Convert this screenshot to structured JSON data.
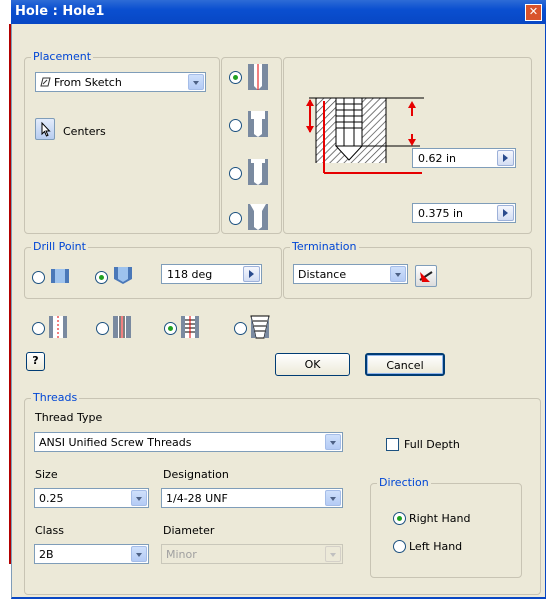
{
  "window": {
    "title": "Hole : Hole1"
  },
  "placement": {
    "legend": "Placement",
    "source_value": "From Sketch",
    "centers_label": "Centers"
  },
  "hole_types": [
    "drilled",
    "counterbore",
    "spotface",
    "countersink"
  ],
  "selected_hole_type": "drilled",
  "preview": {
    "depth_value": "0.62 in",
    "diameter_value": "0.375 in"
  },
  "drill_point": {
    "legend": "Drill Point",
    "options": [
      "flat",
      "angle"
    ],
    "selected": "angle",
    "angle_value": "118 deg"
  },
  "termination": {
    "legend": "Termination",
    "value": "Distance"
  },
  "hole_styles": [
    "simple",
    "clearance",
    "tapped",
    "taper-tapped"
  ],
  "selected_hole_style": "tapped",
  "buttons": {
    "ok": "OK",
    "cancel": "Cancel",
    "help": "?"
  },
  "threads": {
    "legend": "Threads",
    "thread_type_label": "Thread Type",
    "thread_type_value": "ANSI Unified Screw Threads",
    "full_depth_label": "Full Depth",
    "full_depth_checked": false,
    "size_label": "Size",
    "size_value": "0.25",
    "designation_label": "Designation",
    "designation_value": "1/4-28 UNF",
    "class_label": "Class",
    "class_value": "2B",
    "diameter_label": "Diameter",
    "diameter_value": "Minor",
    "direction": {
      "legend": "Direction",
      "right_hand_label": "Right Hand",
      "left_hand_label": "Left Hand",
      "selected": "right"
    }
  },
  "colors": {
    "titlebar": "#0a4fd0",
    "dialog_bg": "#ece9d8",
    "legend": "#0046d5",
    "radio_on": "#21a121",
    "diagram_red": "#e60000"
  }
}
